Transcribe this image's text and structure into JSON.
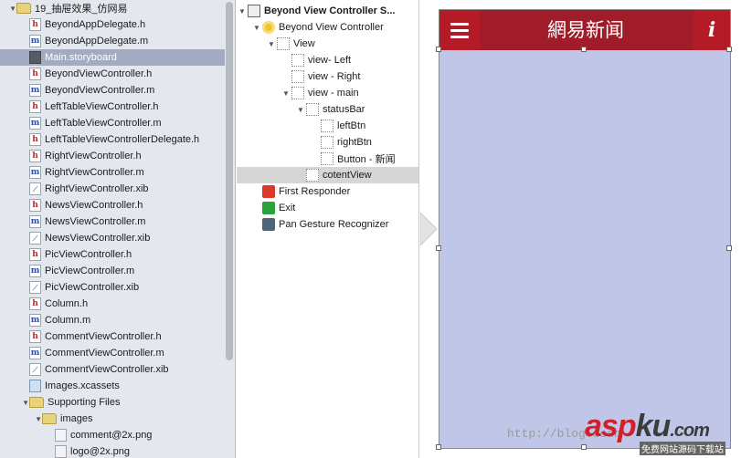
{
  "navigator": {
    "items": [
      {
        "label": "19_抽屉效果_仿网易",
        "type": "folder",
        "indent": 1,
        "disclosure": "open"
      },
      {
        "label": "BeyondAppDelegate.h",
        "type": "h",
        "indent": 2
      },
      {
        "label": "BeyondAppDelegate.m",
        "type": "m",
        "indent": 2
      },
      {
        "label": "Main.storyboard",
        "type": "sb",
        "indent": 2,
        "selected": true
      },
      {
        "label": "BeyondViewController.h",
        "type": "h",
        "indent": 2
      },
      {
        "label": "BeyondViewController.m",
        "type": "m",
        "indent": 2
      },
      {
        "label": "LeftTableViewController.h",
        "type": "h",
        "indent": 2
      },
      {
        "label": "LeftTableViewController.m",
        "type": "m",
        "indent": 2
      },
      {
        "label": "LeftTableViewControllerDelegate.h",
        "type": "h",
        "indent": 2
      },
      {
        "label": "RightViewController.h",
        "type": "h",
        "indent": 2
      },
      {
        "label": "RightViewController.m",
        "type": "m",
        "indent": 2
      },
      {
        "label": "RightViewController.xib",
        "type": "xib",
        "indent": 2
      },
      {
        "label": "NewsViewController.h",
        "type": "h",
        "indent": 2
      },
      {
        "label": "NewsViewController.m",
        "type": "m",
        "indent": 2
      },
      {
        "label": "NewsViewController.xib",
        "type": "xib",
        "indent": 2
      },
      {
        "label": "PicViewController.h",
        "type": "h",
        "indent": 2
      },
      {
        "label": "PicViewController.m",
        "type": "m",
        "indent": 2
      },
      {
        "label": "PicViewController.xib",
        "type": "xib",
        "indent": 2
      },
      {
        "label": "Column.h",
        "type": "h",
        "indent": 2
      },
      {
        "label": "Column.m",
        "type": "m",
        "indent": 2
      },
      {
        "label": "CommentViewController.h",
        "type": "h",
        "indent": 2
      },
      {
        "label": "CommentViewController.m",
        "type": "m",
        "indent": 2
      },
      {
        "label": "CommentViewController.xib",
        "type": "xib",
        "indent": 2
      },
      {
        "label": "Images.xcassets",
        "type": "assets",
        "indent": 2
      },
      {
        "label": "Supporting Files",
        "type": "folder",
        "indent": 2,
        "disclosure": "open"
      },
      {
        "label": "images",
        "type": "folder",
        "indent": 3,
        "disclosure": "open"
      },
      {
        "label": "comment@2x.png",
        "type": "png",
        "indent": 4
      },
      {
        "label": "logo@2x.png",
        "type": "png",
        "indent": 4
      }
    ]
  },
  "outline": {
    "items": [
      {
        "label": "Beyond View Controller S...",
        "icon": "scene",
        "indent": 0,
        "disclosure": "open",
        "bold": true
      },
      {
        "label": "Beyond View Controller",
        "icon": "vc",
        "indent": 1,
        "disclosure": "open"
      },
      {
        "label": "View",
        "icon": "view",
        "indent": 2,
        "disclosure": "open"
      },
      {
        "label": "view- Left",
        "icon": "view",
        "indent": 3
      },
      {
        "label": "view - Right",
        "icon": "view",
        "indent": 3
      },
      {
        "label": "view - main",
        "icon": "view",
        "indent": 3,
        "disclosure": "open"
      },
      {
        "label": "statusBar",
        "icon": "view",
        "indent": 4,
        "disclosure": "open"
      },
      {
        "label": "leftBtn",
        "icon": "view",
        "indent": 5
      },
      {
        "label": "rightBtn",
        "icon": "view",
        "indent": 5
      },
      {
        "label": "Button - 新闻",
        "icon": "view",
        "indent": 5
      },
      {
        "label": "cotentView",
        "icon": "view",
        "indent": 4,
        "selected": true
      },
      {
        "label": "First Responder",
        "icon": "fr",
        "indent": 1
      },
      {
        "label": "Exit",
        "icon": "exit",
        "indent": 1
      },
      {
        "label": "Pan Gesture Recognizer",
        "icon": "pan",
        "indent": 1
      }
    ]
  },
  "canvas": {
    "title": "網易新闻",
    "right_btn_label": "i",
    "colors": {
      "statusbar": "#a11c29",
      "button": "#b51b27",
      "content": "#bfc6e7"
    }
  },
  "watermark": {
    "url": "http://blog.csdn",
    "logo_a": "asp",
    "logo_b": "ku",
    "logo_c": ".com",
    "tag": "免费网站源码下载站"
  }
}
